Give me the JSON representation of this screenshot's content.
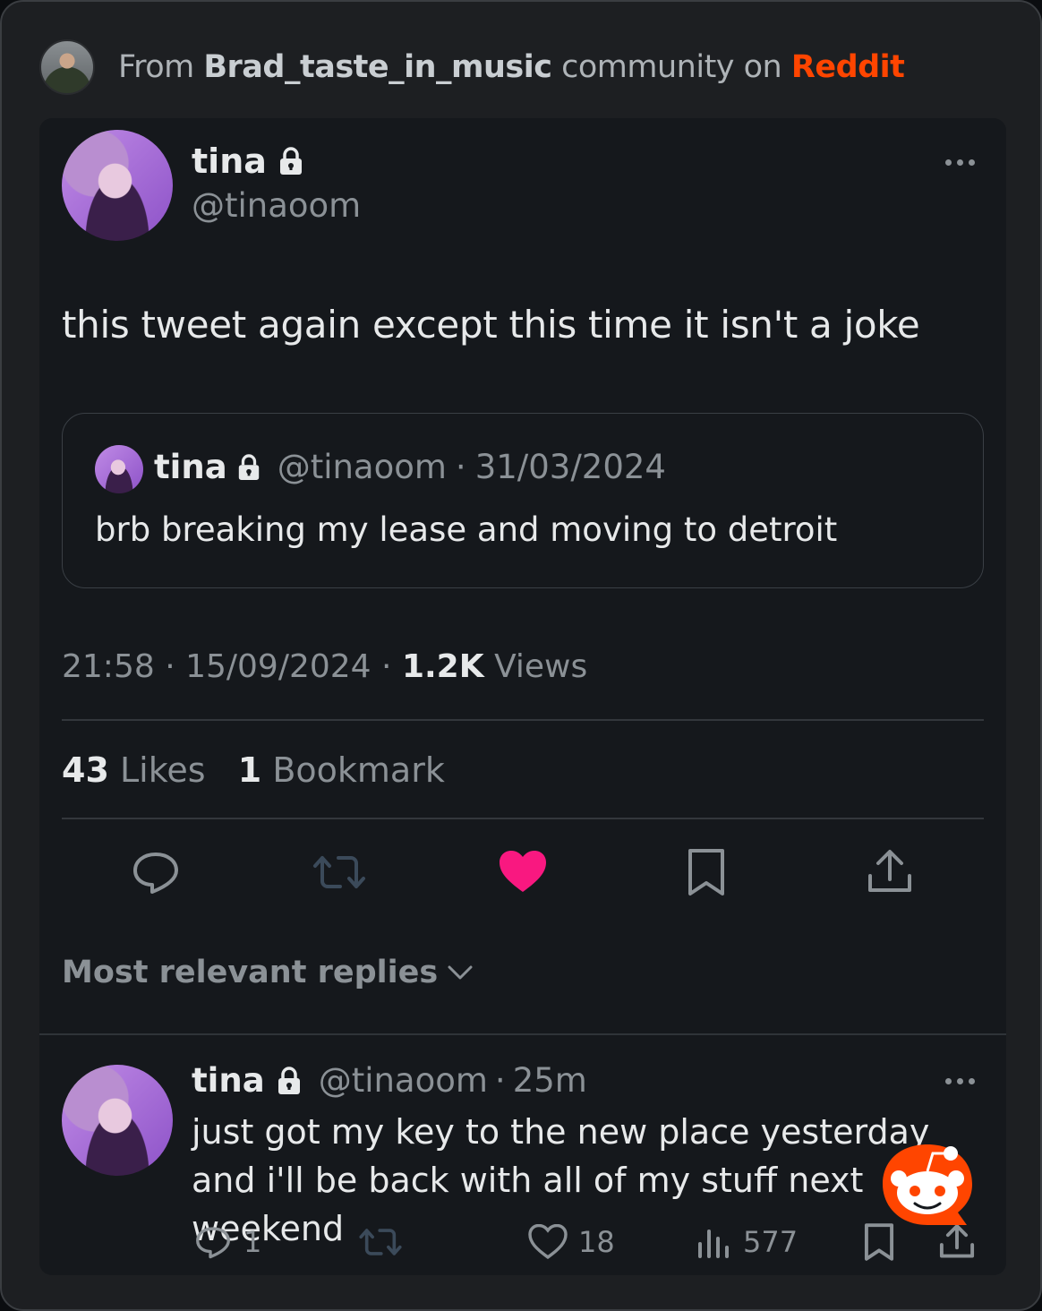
{
  "header": {
    "prefix": "From",
    "community": "Brad_taste_in_music",
    "middle": "community on",
    "platform": "Reddit"
  },
  "tweet": {
    "author_name": "tina",
    "handle": "@tinaoom",
    "text": "this tweet again except this time it isn't a joke",
    "quote": {
      "author_name": "tina",
      "handle": "@tinaoom",
      "separator": "·",
      "date": "31/03/2024",
      "text": "brb breaking my lease and moving to detroit"
    },
    "time": "21:58",
    "date": "15/09/2024",
    "views_count": "1.2K",
    "views_label": "Views",
    "likes_count": "43",
    "likes_label": "Likes",
    "bookmarks_count": "1",
    "bookmarks_label": "Bookmark"
  },
  "replies_sort": "Most relevant replies",
  "reply": {
    "author_name": "tina",
    "handle": "@tinaoom",
    "separator": "·",
    "age": "25m",
    "text": "just got my key to the new place yesterday and i'll be back with all of my stuff next weekend",
    "reply_count": "1",
    "like_count": "18",
    "view_count": "577"
  },
  "colors": {
    "accent_like": "#f91880",
    "reddit": "#ff4500",
    "card_bg": "#15181c"
  },
  "icons": [
    "lock-icon",
    "more-icon",
    "reply-icon",
    "retweet-icon",
    "heart-icon",
    "bookmark-icon",
    "share-icon",
    "chevron-down-icon",
    "views-icon",
    "reddit-snoo-icon"
  ]
}
